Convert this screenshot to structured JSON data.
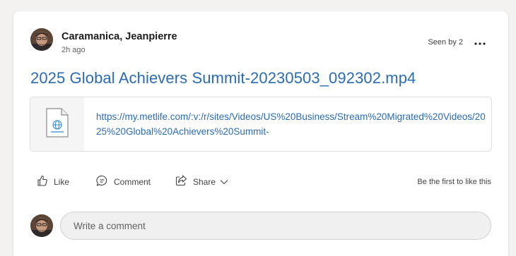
{
  "post": {
    "author_name": "Caramanica, Jeanpierre",
    "timestamp": "2h ago",
    "seen_by": "Seen by 2",
    "title": "2025 Global Achievers Summit-20230503_092302.mp4",
    "link_url": "https://my.metlife.com/:v:/r/sites/Videos/US%20Business/Stream%20Migrated%20Videos/2025%20Global%20Achievers%20Summit-"
  },
  "actions": {
    "like_label": "Like",
    "comment_label": "Comment",
    "share_label": "Share",
    "first_like_text": "Be the first to like this"
  },
  "comment_box": {
    "placeholder": "Write a comment"
  },
  "icons": {
    "avatar": "avatar-photo",
    "more": "more-horizontal-icon",
    "file": "web-file-icon",
    "like": "thumbs-up-icon",
    "comment": "chat-bubble-icon",
    "share": "share-arrow-icon",
    "chevron": "chevron-down-icon"
  },
  "colors": {
    "link": "#2b6cb0",
    "card_background": "#ffffff",
    "page_background": "#f3f2f1"
  }
}
